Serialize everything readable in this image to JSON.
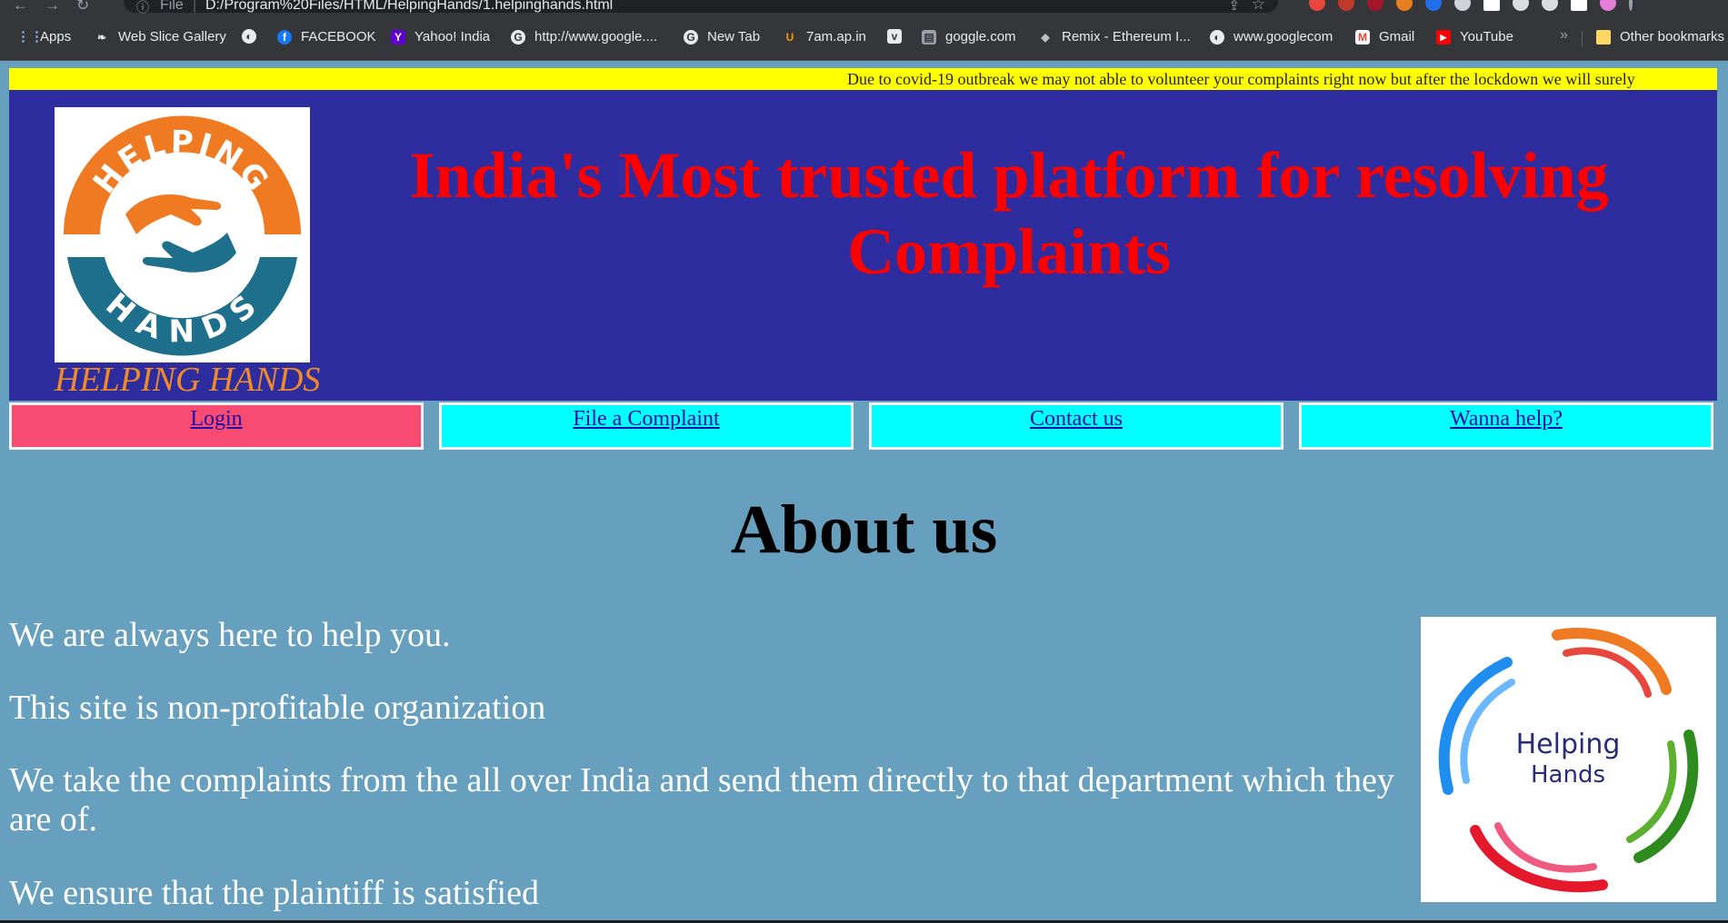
{
  "browser": {
    "scheme_label": "File",
    "url": "D:/Program%20Files/HTML/HelpingHands/1.helpinghands.html",
    "bookmarks": [
      {
        "label": "Apps",
        "icon": "apps-grid-icon"
      },
      {
        "label": "Web Slice Gallery",
        "icon": "web-slice-icon"
      },
      {
        "label": "",
        "icon": "globe-icon"
      },
      {
        "label": "FACEBOOK",
        "icon": "facebook-icon"
      },
      {
        "label": "Yahoo! India",
        "icon": "yahoo-icon"
      },
      {
        "label": "http://www.google....",
        "icon": "google-icon"
      },
      {
        "label": "New Tab",
        "icon": "google-icon"
      },
      {
        "label": "7am.ap.in",
        "icon": "7am-icon"
      },
      {
        "label": "",
        "icon": "vimeo-icon"
      },
      {
        "label": "goggle.com",
        "icon": "image-icon"
      },
      {
        "label": "Remix - Ethereum I...",
        "icon": "remix-icon"
      },
      {
        "label": "www.googlecom",
        "icon": "globe-icon"
      },
      {
        "label": "Gmail",
        "icon": "gmail-icon"
      },
      {
        "label": "YouTube",
        "icon": "youtube-icon"
      }
    ],
    "more_label": "»",
    "other_bookmarks": "Other bookmarks"
  },
  "marquee": {
    "text": "Due to covid-19 outbreak we may not able to volunteer your complaints right now but after the lockdown we will surely"
  },
  "header": {
    "logo_top_text": "HELPING",
    "logo_bottom_text": "HANDS",
    "brand": "HELPING HANDS",
    "headline_line1": "India's Most trusted platform for resolving",
    "headline_line2": "Complaints"
  },
  "nav": {
    "login": "Login",
    "file_complaint": "File a Complaint",
    "contact": "Contact us",
    "help": "Wanna help?"
  },
  "about": {
    "title": "About us",
    "paragraphs": [
      "We are always here to help you.",
      "This site is non-profitable organization",
      "We take the complaints from the all over India and send them directly to that department which they are of.",
      "We ensure that the plaintiff is satisfied"
    ],
    "side_logo_line1": "Helping",
    "side_logo_line2": "Hands"
  },
  "colors": {
    "page_bg": "#679fbe",
    "header_bg": "#2e2da0",
    "headline": "#ff0000",
    "marquee_bg": "#ffff00",
    "login_bg": "#f84b72",
    "nav_bg": "#00ffff",
    "brand": "#f08a2a"
  }
}
